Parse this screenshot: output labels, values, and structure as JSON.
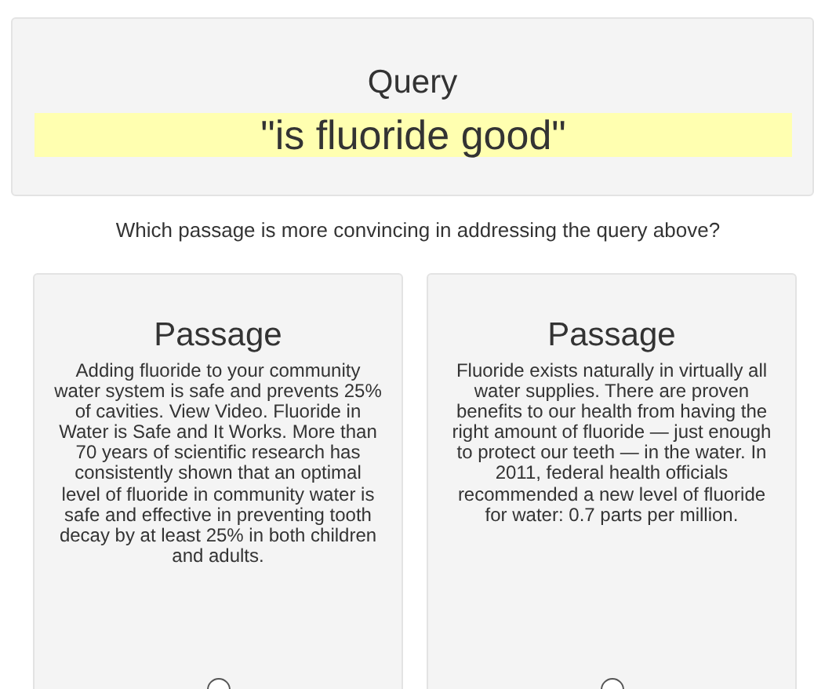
{
  "query": {
    "heading": "Query",
    "text": "\"is fluoride good\""
  },
  "prompt": "Which passage is more convincing in addressing the query above?",
  "passages": [
    {
      "heading": "Passage",
      "text": "Adding fluoride to your community water system is safe and prevents 25% of cavities. View Video. Fluoride in Water is Safe and It Works. More than 70 years of scientific research has consistently shown that an optimal level of fluoride in community water is safe and effective in preventing tooth decay by at least 25% in both children and adults.",
      "selected": false
    },
    {
      "heading": "Passage",
      "text": "Fluoride exists naturally in virtually all water supplies. There are proven benefits to our health from having the right amount of fluoride — just enough to protect our teeth — in the water. In 2011, federal health officials recommended a new level of fluoride for water: 0.7 parts per million.",
      "selected": false
    }
  ]
}
